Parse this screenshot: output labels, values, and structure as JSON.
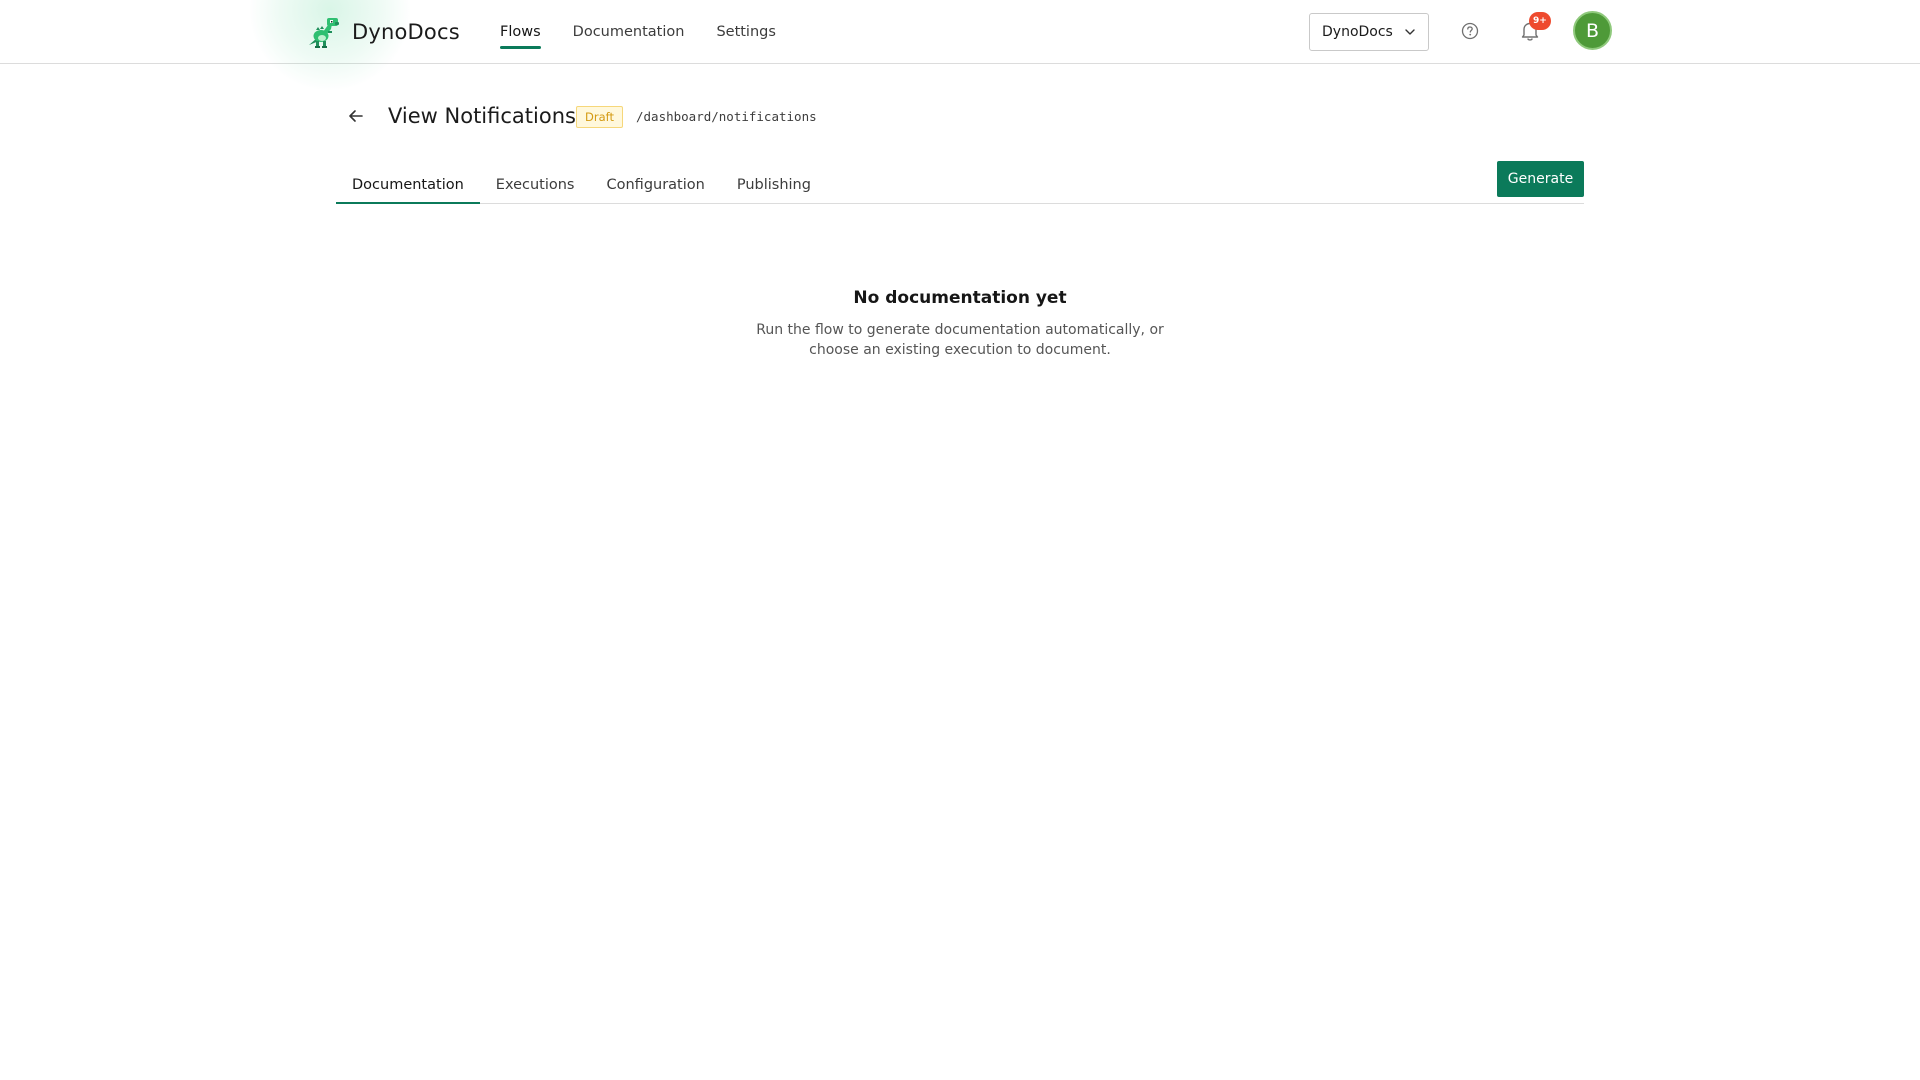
{
  "header": {
    "brand_name": "DynoDocs",
    "nav": [
      {
        "label": "Flows",
        "active": true
      },
      {
        "label": "Documentation",
        "active": false
      },
      {
        "label": "Settings",
        "active": false
      }
    ],
    "org_selector": {
      "value": "DynoDocs",
      "icon": "chevron-down-icon"
    },
    "help_icon": "question-circle-icon",
    "notifications": {
      "icon": "bell-icon",
      "badge": "9+"
    },
    "avatar_initial": "B"
  },
  "page": {
    "title": "View Notifications",
    "status": "Draft",
    "route": "/dashboard/notifications",
    "back_icon": "arrow-left-icon"
  },
  "tabs": [
    {
      "label": "Documentation",
      "active": true
    },
    {
      "label": "Executions",
      "active": false
    },
    {
      "label": "Configuration",
      "active": false
    },
    {
      "label": "Publishing",
      "active": false
    }
  ],
  "actions": {
    "generate_label": "Generate"
  },
  "empty_state": {
    "title": "No documentation yet",
    "text": "Run the flow to generate documentation automatically, or choose an existing execution to document."
  },
  "colors": {
    "accent": "#0b7a5a",
    "badge_red": "#ee4a2e",
    "avatar_green": "#4e9a38",
    "draft_text": "#d49a12",
    "draft_bg": "#fff8dc"
  }
}
